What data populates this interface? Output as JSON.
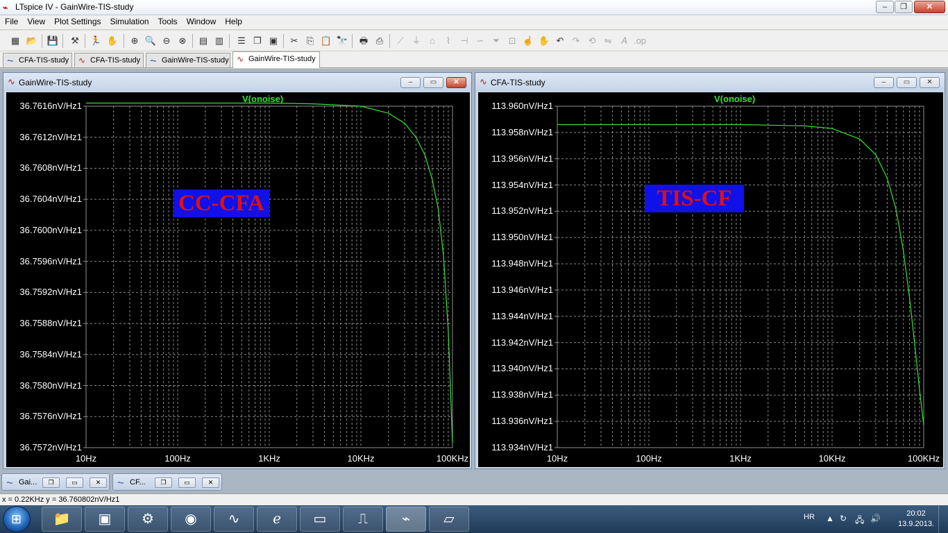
{
  "window": {
    "title": "LTspice IV - GainWire-TIS-study",
    "minimize": "–",
    "restore": "❐",
    "close": "✕"
  },
  "menu": [
    "File",
    "View",
    "Plot Settings",
    "Simulation",
    "Tools",
    "Window",
    "Help"
  ],
  "doc_tabs": [
    {
      "label": "CFA-TIS-study",
      "icon": "schematic-icon",
      "active": false
    },
    {
      "label": "CFA-TIS-study",
      "icon": "waveform-icon",
      "active": false
    },
    {
      "label": "GainWire-TIS-study",
      "icon": "schematic-icon",
      "active": false
    },
    {
      "label": "GainWire-TIS-study",
      "icon": "waveform-icon",
      "active": true
    }
  ],
  "mdi_button_glyphs": {
    "minimize": "–",
    "restore": "▭",
    "close": "✕"
  },
  "plots": [
    {
      "window_title": "GainWire-TIS-study",
      "overlay_text": "CC-CFA",
      "chart_data": {
        "type": "line",
        "title": "V(onoise)",
        "x_scale": "log",
        "x_ticks": [
          "10Hz",
          "100Hz",
          "1KHz",
          "10KHz",
          "100KHz"
        ],
        "xlim_hz": [
          10,
          100000
        ],
        "y_ticks": [
          "36.7616nV/Hz1",
          "36.7612nV/Hz1",
          "36.7608nV/Hz1",
          "36.7604nV/Hz1",
          "36.7600nV/Hz1",
          "36.7596nV/Hz1",
          "36.7592nV/Hz1",
          "36.7588nV/Hz1",
          "36.7584nV/Hz1",
          "36.7580nV/Hz1",
          "36.7576nV/Hz1",
          "36.7572nV/Hz1"
        ],
        "ylim": [
          36.7572,
          36.7616
        ],
        "grid": true,
        "series": [
          {
            "color": "#32e432",
            "x": [
              10,
              100,
              1000,
              3000,
              10000,
              20000,
              30000,
              40000,
              50000,
              60000,
              70000,
              80000,
              90000,
              100000
            ],
            "y": [
              36.76164,
              36.76164,
              36.76164,
              36.76163,
              36.7616,
              36.76151,
              36.76138,
              36.7612,
              36.76097,
              36.76066,
              36.76027,
              36.75966,
              36.75869,
              36.75725
            ]
          }
        ]
      }
    },
    {
      "window_title": "CFA-TIS-study",
      "overlay_text": "TIS-CF",
      "chart_data": {
        "type": "line",
        "title": "V(onoise)",
        "x_scale": "log",
        "x_ticks": [
          "10Hz",
          "100Hz",
          "1KHz",
          "10KHz",
          "100KHz"
        ],
        "xlim_hz": [
          10,
          100000
        ],
        "y_ticks": [
          "113.960nV/Hz1",
          "113.958nV/Hz1",
          "113.956nV/Hz1",
          "113.954nV/Hz1",
          "113.952nV/Hz1",
          "113.950nV/Hz1",
          "113.948nV/Hz1",
          "113.946nV/Hz1",
          "113.944nV/Hz1",
          "113.942nV/Hz1",
          "113.940nV/Hz1",
          "113.938nV/Hz1",
          "113.936nV/Hz1",
          "113.934nV/Hz1"
        ],
        "ylim": [
          113.934,
          113.96
        ],
        "grid": true,
        "series": [
          {
            "color": "#32e432",
            "x": [
              10,
              100,
              1000,
              5000,
              10000,
              20000,
              30000,
              40000,
              50000,
              60000,
              70000,
              80000,
              90000,
              100000
            ],
            "y": [
              113.9586,
              113.9586,
              113.9586,
              113.9585,
              113.9583,
              113.9575,
              113.9563,
              113.9545,
              113.9521,
              113.949,
              113.9454,
              113.9418,
              113.9384,
              113.9357
            ]
          }
        ]
      }
    }
  ],
  "minimized_windows": [
    {
      "label": "Gai...",
      "icon": "schematic-icon"
    },
    {
      "label": "CF...",
      "icon": "schematic-icon"
    }
  ],
  "status": "x = 0.22KHz   y = 36.760802nV/Hz1",
  "taskbar": {
    "language": "HR",
    "time": "20:02",
    "date": "13.9.2013."
  }
}
